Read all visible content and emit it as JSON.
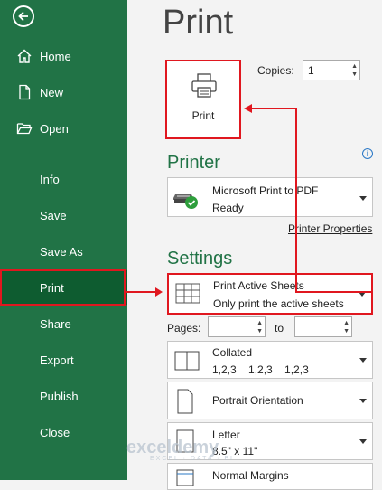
{
  "sidebar": {
    "items": [
      {
        "label": "Home",
        "icon": "home-icon"
      },
      {
        "label": "New",
        "icon": "new-document-icon"
      },
      {
        "label": "Open",
        "icon": "folder-open-icon"
      },
      {
        "label": "Info"
      },
      {
        "label": "Save"
      },
      {
        "label": "Save As"
      },
      {
        "label": "Print",
        "selected": true
      },
      {
        "label": "Share"
      },
      {
        "label": "Export"
      },
      {
        "label": "Publish"
      },
      {
        "label": "Close"
      }
    ]
  },
  "main": {
    "title": "Print",
    "print_button_label": "Print",
    "copies_label": "Copies:",
    "copies_value": "1",
    "printer_heading": "Printer",
    "printer_name": "Microsoft Print to PDF",
    "printer_status": "Ready",
    "printer_properties_link": "Printer Properties",
    "settings_heading": "Settings",
    "print_what": {
      "title": "Print Active Sheets",
      "subtitle": "Only print the active sheets"
    },
    "pages_label": "Pages:",
    "to_label": "to",
    "collation": {
      "title": "Collated",
      "subtitle": "1,2,3    1,2,3    1,2,3"
    },
    "orientation": {
      "title": "Portrait Orientation"
    },
    "paper": {
      "title": "Letter",
      "subtitle": "8.5\" x 11\""
    },
    "margins": {
      "title": "Normal Margins"
    }
  },
  "watermark": {
    "brand": "exceldemy",
    "tagline": "EXCEL · DATA · BI"
  },
  "colors": {
    "accent": "#217346",
    "highlight": "#e0171f",
    "info": "#2b78c6"
  }
}
